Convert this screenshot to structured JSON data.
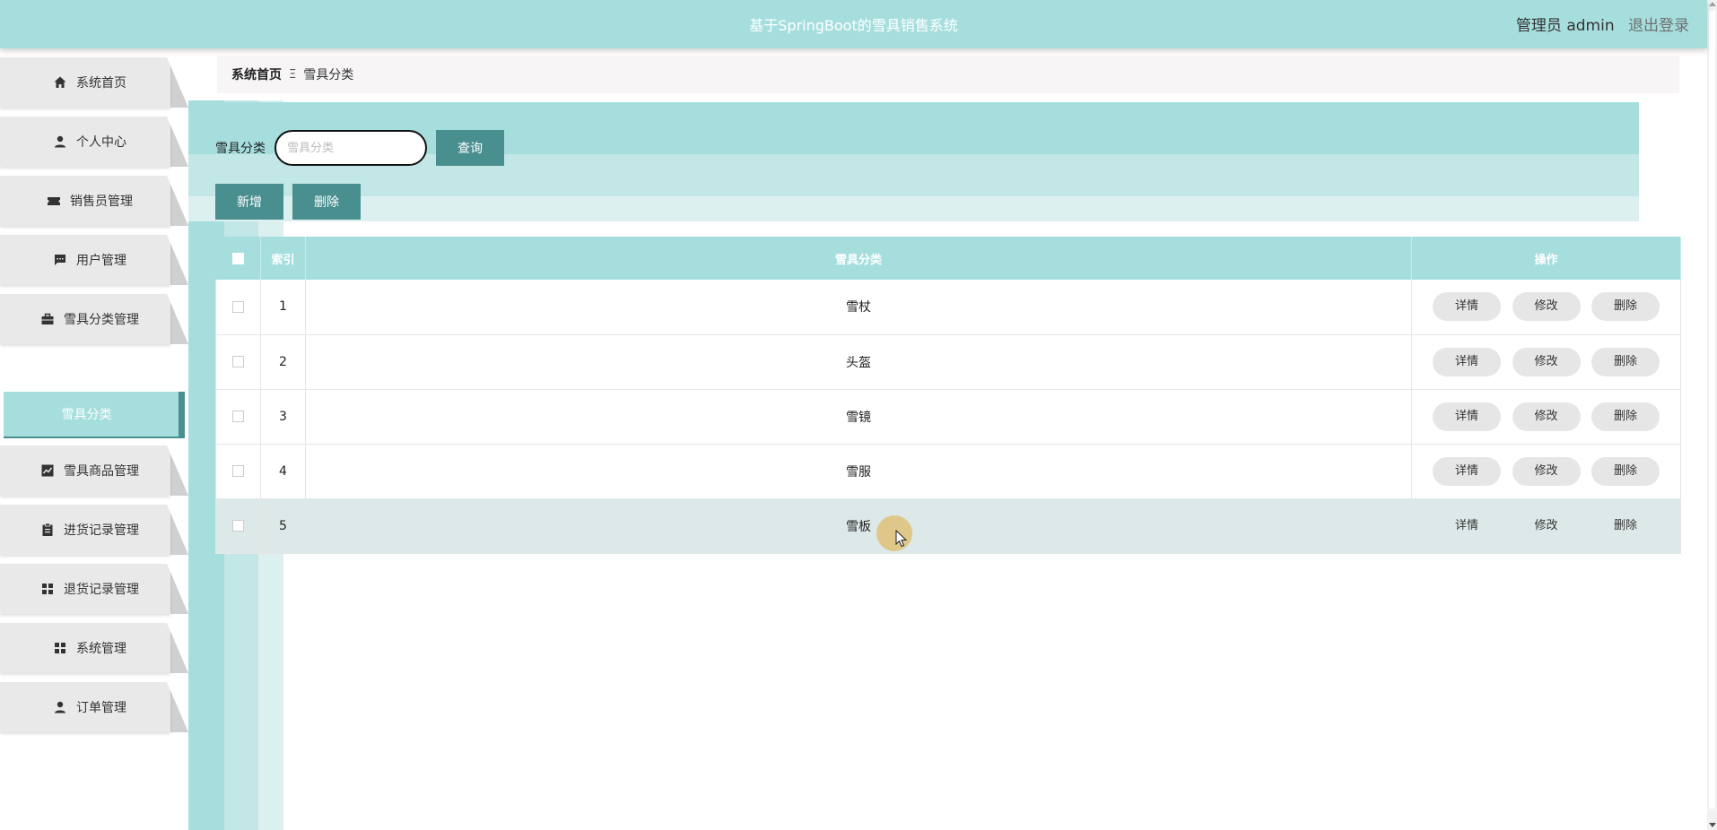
{
  "header": {
    "title": "基于SpringBoot的雪具销售系统",
    "user_label": "管理员 admin",
    "logout_label": "退出登录"
  },
  "sidebar": {
    "items": [
      {
        "label": "系统首页",
        "icon": "home-icon"
      },
      {
        "label": "个人中心",
        "icon": "person-icon"
      },
      {
        "label": "销售员管理",
        "icon": "ticket-icon"
      },
      {
        "label": "用户管理",
        "icon": "chat-icon"
      },
      {
        "label": "雪具分类管理",
        "icon": "briefcase-icon"
      },
      {
        "label": "雪具商品管理",
        "icon": "chart-icon"
      },
      {
        "label": "进货记录管理",
        "icon": "clipboard-icon"
      },
      {
        "label": "退货记录管理",
        "icon": "grid-icon"
      },
      {
        "label": "系统管理",
        "icon": "grid-icon"
      },
      {
        "label": "订单管理",
        "icon": "person-icon"
      }
    ],
    "active_sub": "雪具分类"
  },
  "breadcrumb": {
    "home": "系统首页",
    "separator": "Ξ",
    "current": "雪具分类"
  },
  "search": {
    "label": "雪具分类",
    "placeholder": "雪具分类",
    "value": "",
    "button": "查询"
  },
  "actions": {
    "add": "新增",
    "delete": "删除"
  },
  "table": {
    "headers": {
      "index": "索引",
      "category": "雪具分类",
      "operation": "操作"
    },
    "rows": [
      {
        "index": "1",
        "category": "雪杖"
      },
      {
        "index": "2",
        "category": "头盔"
      },
      {
        "index": "3",
        "category": "雪镜"
      },
      {
        "index": "4",
        "category": "雪服"
      },
      {
        "index": "5",
        "category": "雪板"
      }
    ],
    "row_actions": {
      "detail": "详情",
      "edit": "修改",
      "delete": "删除"
    }
  },
  "colors": {
    "primary": "#a6dede",
    "accent": "#4a8f8f",
    "highlight_row": "#dde8e9"
  }
}
